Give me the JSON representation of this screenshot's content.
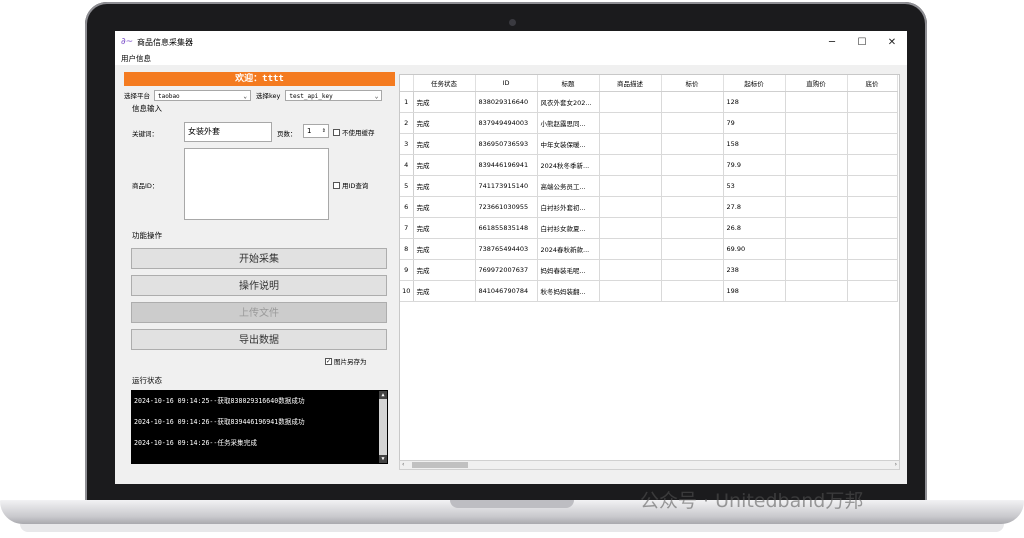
{
  "window": {
    "title": "商品信息采集器",
    "menu": [
      "用户信息"
    ],
    "controls": [
      "─",
      "☐",
      "✕"
    ]
  },
  "welcome": "欢迎：tttt",
  "platform": {
    "label": "选择平台",
    "value": "taobao"
  },
  "key": {
    "label": "选择key",
    "value": "test_api_key"
  },
  "info_input": {
    "title": "信息输入",
    "keyword_label": "关键词：",
    "keyword_value": "女装外套",
    "pages_label": "页数：",
    "pages_value": "1",
    "no_cache_label": "不使用缓存",
    "product_id_label": "商品ID：",
    "use_id_query_label": "用ID查询"
  },
  "actions": {
    "title": "功能操作",
    "start": "开始采集",
    "help": "操作说明",
    "upload": "上传文件",
    "export": "导出数据",
    "save_images_label": "图片另存为"
  },
  "status": {
    "title": "运行状态",
    "lines": [
      "2024-10-16 09:14:25--获取838029316640数据成功",
      "2024-10-16 09:14:26--获取839446196941数据成功",
      "2024-10-16 09:14:26--任务采集完成"
    ]
  },
  "table": {
    "columns": [
      "任务状态",
      "ID",
      "标题",
      "商品描述",
      "标价",
      "起标价",
      "直购价",
      "底价"
    ],
    "rows": [
      [
        "1",
        "完成",
        "838029316640",
        "风衣外套女202...",
        "",
        "",
        "128",
        "",
        ""
      ],
      [
        "2",
        "完成",
        "837949494003",
        "小熊赵露思同...",
        "",
        "",
        "79",
        "",
        ""
      ],
      [
        "3",
        "完成",
        "836950736593",
        "中年女装保暖...",
        "",
        "",
        "158",
        "",
        ""
      ],
      [
        "4",
        "完成",
        "839446196941",
        "2024秋冬季新...",
        "",
        "",
        "79.9",
        "",
        ""
      ],
      [
        "5",
        "完成",
        "741173915140",
        "高端公务员工...",
        "",
        "",
        "53",
        "",
        ""
      ],
      [
        "6",
        "完成",
        "723661030955",
        "白衬衫外套初...",
        "",
        "",
        "27.8",
        "",
        ""
      ],
      [
        "7",
        "完成",
        "661855835148",
        "白衬衫女款夏...",
        "",
        "",
        "26.8",
        "",
        ""
      ],
      [
        "8",
        "完成",
        "738765494403",
        "2024春秋新款...",
        "",
        "",
        "69.90",
        "",
        ""
      ],
      [
        "9",
        "完成",
        "769972007637",
        "妈妈春装毛呢...",
        "",
        "",
        "238",
        "",
        ""
      ],
      [
        "10",
        "完成",
        "841046790784",
        "秋冬妈妈装翻...",
        "",
        "",
        "198",
        "",
        ""
      ]
    ]
  },
  "watermark": "公众号 · Unitedband万邦"
}
